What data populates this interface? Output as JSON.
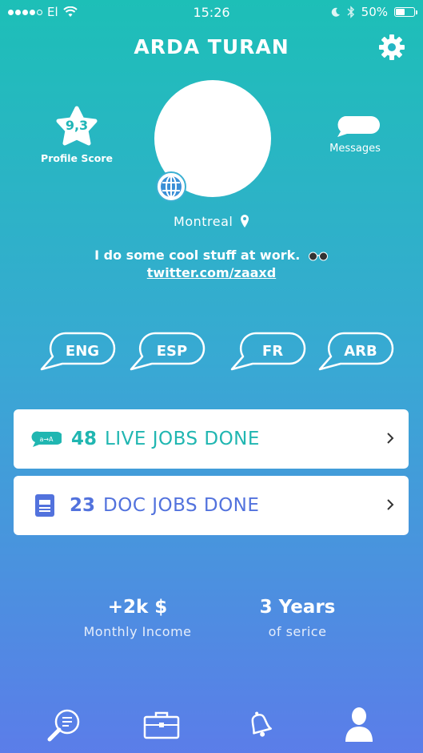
{
  "status_bar": {
    "carrier": "El",
    "time": "15:26",
    "battery": "50%",
    "signal_bars": 4,
    "battery_level": 0.5
  },
  "header": {
    "title": "ARDA TURAN",
    "settings_icon": "gear-icon"
  },
  "profile": {
    "score": "9,3",
    "score_label": "Profile Score",
    "messages_label": "Messages",
    "location": "Montreal",
    "bio": "I do some cool stuff at work.",
    "bio_emoji": "glasses-icon",
    "link": "twitter.com/zaaxd"
  },
  "languages": [
    {
      "label": "ENG"
    },
    {
      "label": "ESP"
    },
    {
      "label": "FR"
    },
    {
      "label": "ARB"
    }
  ],
  "jobs": {
    "live": {
      "count": "48",
      "label": "LIVE JOBS DONE",
      "icon": "chat-translate-icon",
      "color": "#20b6b1"
    },
    "doc": {
      "count": "23",
      "label": "DOC JOBS DONE",
      "icon": "document-icon",
      "color": "#5272dd"
    }
  },
  "stats": {
    "income_value": "+2k $",
    "income_label": "Monthly Income",
    "years_value": "3 Years",
    "years_label": "of serice"
  },
  "tabbar": {
    "items": [
      "search-icon",
      "briefcase-icon",
      "bell-icon",
      "profile-icon"
    ],
    "active": "profile-icon"
  },
  "colors": {
    "gradient_top": "#1dbfb7",
    "gradient_bottom": "#5b7de9"
  }
}
